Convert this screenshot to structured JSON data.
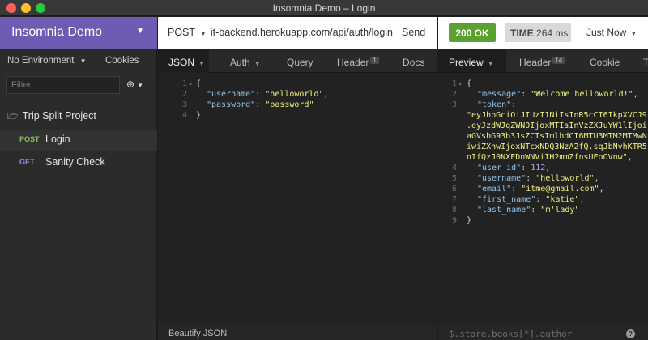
{
  "window": {
    "title": "Insomnia Demo – Login"
  },
  "sidebar": {
    "workspace": "Insomnia Demo",
    "environment": "No Environment",
    "cookies": "Cookies",
    "filter_placeholder": "Filter",
    "folder": "Trip Split Project",
    "requests": [
      {
        "method": "POST",
        "name": "Login",
        "active": true
      },
      {
        "method": "GET",
        "name": "Sanity Check",
        "active": false
      }
    ]
  },
  "request": {
    "method": "POST",
    "url": "https://trip-split-backend.herokuapp.com/api/auth/login",
    "send": "Send",
    "tabs": [
      {
        "label": "JSON",
        "active": true
      },
      {
        "label": "Auth"
      },
      {
        "label": "Query"
      },
      {
        "label": "Header",
        "badge": "1"
      },
      {
        "label": "Docs"
      }
    ],
    "body_lines": [
      "1",
      "2",
      "3",
      "4"
    ],
    "body": {
      "username": "helloworld",
      "password": "password"
    },
    "footer": "Beautify JSON"
  },
  "response": {
    "status": "200 OK",
    "time_label": "TIME",
    "time_value": "264 ms",
    "timestamp": "Just Now",
    "tabs": [
      {
        "label": "Preview",
        "active": true
      },
      {
        "label": "Header",
        "badge": "14"
      },
      {
        "label": "Cookie"
      },
      {
        "label": "T"
      }
    ],
    "body": {
      "message": "Welcome helloworld!",
      "token_lines": [
        "eyJhbGciOiJIUzI1NiIsInR5cCI6IkpXVCJ9",
        ".eyJzdWJqZWN0IjoxMTIsInVzZXJuYW1lIjoi",
        "aGVsbG93b3JsZCIsImlhdCI6MTU3MTM2MTMwN",
        "iwiZXhwIjoxNTcxNDQ3NzA2fQ.sqJbNvhKTR5",
        "oIfQzJ0NXFDnWNViIH2mmZfnsUEoOVnw"
      ],
      "user_id": "112",
      "username": "helloworld",
      "email": "itme@gmail.com",
      "first_name": "katie",
      "last_name": "m'lady"
    },
    "line_numbers": [
      "1",
      "2",
      "3",
      "",
      "",
      "",
      "",
      "4",
      "5",
      "6",
      "7",
      "8",
      "9"
    ],
    "filter_placeholder": "$.store.books[*].author",
    "help": "?"
  }
}
